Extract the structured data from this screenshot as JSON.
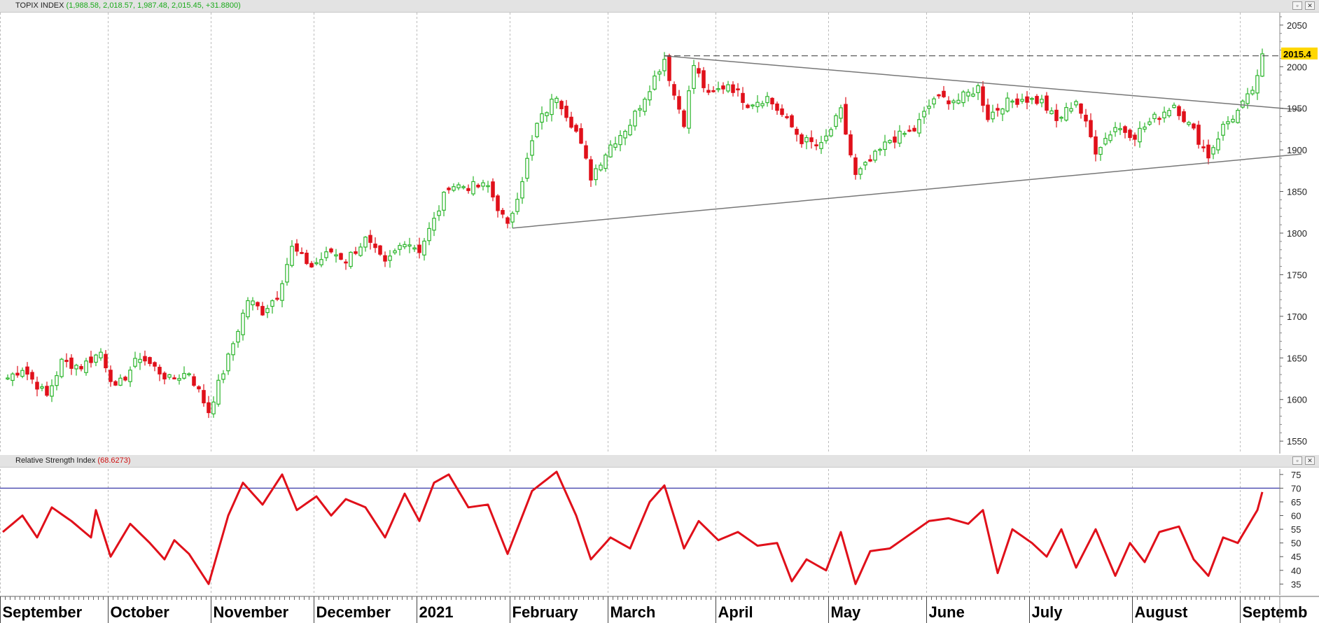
{
  "price_panel": {
    "title": "TOPIX INDEX",
    "values": "(1,988.58, 2,018.57, 1,987.48, 2,015.45, +31.8800)",
    "last_label": "2015.4",
    "buttons": {
      "restore": "▫",
      "close": "✕"
    }
  },
  "rsi_panel": {
    "title": "Relative Strength Index",
    "values": "(68.6273)",
    "buttons": {
      "restore": "▫",
      "close": "✕"
    }
  },
  "colors": {
    "up": "#2cb52c",
    "down": "#e0101a",
    "rsi_line": "#e0101a",
    "rsi_level": "#3a3aa8",
    "trend_line": "#777777",
    "grid": "#bcbcbc",
    "last_label_bg": "#ffd700"
  },
  "chart_data": [
    {
      "type": "candlestick",
      "title": "TOPIX INDEX",
      "y_ticks": [
        1550,
        1600,
        1650,
        1700,
        1750,
        1800,
        1850,
        1900,
        1950,
        2000,
        2050
      ],
      "ylim": [
        1535,
        2065
      ],
      "x_labels": [
        "September",
        "October",
        "November",
        "December",
        "2021",
        "February",
        "March",
        "April",
        "May",
        "June",
        "July",
        "August",
        "Septemb"
      ],
      "x_label_index": [
        0,
        22,
        43,
        64,
        85,
        104,
        124,
        146,
        169,
        189,
        210,
        231,
        253
      ],
      "total_sessions": 260,
      "anchors": [
        {
          "d": 0,
          "c": 1622
        },
        {
          "d": 4,
          "c": 1638
        },
        {
          "d": 9,
          "c": 1604
        },
        {
          "d": 12,
          "c": 1645
        },
        {
          "d": 16,
          "c": 1640
        },
        {
          "d": 20,
          "c": 1657
        },
        {
          "d": 23,
          "c": 1612
        },
        {
          "d": 28,
          "c": 1652
        },
        {
          "d": 34,
          "c": 1624
        },
        {
          "d": 38,
          "c": 1633
        },
        {
          "d": 42,
          "c": 1586
        },
        {
          "d": 46,
          "c": 1650
        },
        {
          "d": 50,
          "c": 1720
        },
        {
          "d": 53,
          "c": 1706
        },
        {
          "d": 56,
          "c": 1726
        },
        {
          "d": 59,
          "c": 1782
        },
        {
          "d": 63,
          "c": 1760
        },
        {
          "d": 67,
          "c": 1778
        },
        {
          "d": 70,
          "c": 1768
        },
        {
          "d": 74,
          "c": 1792
        },
        {
          "d": 78,
          "c": 1762
        },
        {
          "d": 82,
          "c": 1792
        },
        {
          "d": 85,
          "c": 1780
        },
        {
          "d": 88,
          "c": 1815
        },
        {
          "d": 91,
          "c": 1858
        },
        {
          "d": 95,
          "c": 1856
        },
        {
          "d": 99,
          "c": 1856
        },
        {
          "d": 103,
          "c": 1807
        },
        {
          "d": 106,
          "c": 1866
        },
        {
          "d": 109,
          "c": 1930
        },
        {
          "d": 113,
          "c": 1966
        },
        {
          "d": 117,
          "c": 1922
        },
        {
          "d": 120,
          "c": 1868
        },
        {
          "d": 124,
          "c": 1906
        },
        {
          "d": 128,
          "c": 1932
        },
        {
          "d": 132,
          "c": 1976
        },
        {
          "d": 135,
          "c": 2010
        },
        {
          "d": 137,
          "c": 1966
        },
        {
          "d": 139,
          "c": 1934
        },
        {
          "d": 141,
          "c": 2002
        },
        {
          "d": 144,
          "c": 1964
        },
        {
          "d": 148,
          "c": 1980
        },
        {
          "d": 152,
          "c": 1956
        },
        {
          "d": 156,
          "c": 1963
        },
        {
          "d": 160,
          "c": 1935
        },
        {
          "d": 163,
          "c": 1912
        },
        {
          "d": 167,
          "c": 1904
        },
        {
          "d": 171,
          "c": 1946
        },
        {
          "d": 174,
          "c": 1868
        },
        {
          "d": 177,
          "c": 1886
        },
        {
          "d": 181,
          "c": 1912
        },
        {
          "d": 186,
          "c": 1924
        },
        {
          "d": 190,
          "c": 1962
        },
        {
          "d": 195,
          "c": 1960
        },
        {
          "d": 199,
          "c": 1975
        },
        {
          "d": 201,
          "c": 1940
        },
        {
          "d": 204,
          "c": 1955
        },
        {
          "d": 208,
          "c": 1962
        },
        {
          "d": 212,
          "c": 1958
        },
        {
          "d": 215,
          "c": 1934
        },
        {
          "d": 219,
          "c": 1960
        },
        {
          "d": 223,
          "c": 1900
        },
        {
          "d": 227,
          "c": 1928
        },
        {
          "d": 231,
          "c": 1918
        },
        {
          "d": 235,
          "c": 1938
        },
        {
          "d": 239,
          "c": 1955
        },
        {
          "d": 243,
          "c": 1922
        },
        {
          "d": 246,
          "c": 1893
        },
        {
          "d": 249,
          "c": 1928
        },
        {
          "d": 252,
          "c": 1946
        },
        {
          "d": 254,
          "c": 1962
        },
        {
          "d": 256,
          "c": 1984
        },
        {
          "d": 257,
          "c": 2015.45
        }
      ],
      "trendlines": [
        {
          "from": [
            135,
            2013
          ],
          "to": [
            265,
            1948
          ]
        },
        {
          "from": [
            104,
            1806
          ],
          "to": [
            265,
            1895
          ]
        }
      ],
      "resistance_level": 2013,
      "last_value": 2015.45
    },
    {
      "type": "line",
      "title": "Relative Strength Index",
      "y_ticks": [
        35,
        40,
        45,
        50,
        55,
        60,
        65,
        70,
        75
      ],
      "ylim": [
        31,
        77
      ],
      "level": 70,
      "anchors": [
        {
          "d": 0,
          "v": 54
        },
        {
          "d": 4,
          "v": 60
        },
        {
          "d": 7,
          "v": 52
        },
        {
          "d": 10,
          "v": 63
        },
        {
          "d": 14,
          "v": 58
        },
        {
          "d": 18,
          "v": 52
        },
        {
          "d": 19,
          "v": 62
        },
        {
          "d": 22,
          "v": 45
        },
        {
          "d": 26,
          "v": 57
        },
        {
          "d": 30,
          "v": 50
        },
        {
          "d": 33,
          "v": 44
        },
        {
          "d": 35,
          "v": 51
        },
        {
          "d": 38,
          "v": 46
        },
        {
          "d": 42,
          "v": 35
        },
        {
          "d": 46,
          "v": 60
        },
        {
          "d": 49,
          "v": 72
        },
        {
          "d": 53,
          "v": 64
        },
        {
          "d": 57,
          "v": 75
        },
        {
          "d": 60,
          "v": 62
        },
        {
          "d": 64,
          "v": 67
        },
        {
          "d": 67,
          "v": 60
        },
        {
          "d": 70,
          "v": 66
        },
        {
          "d": 74,
          "v": 63
        },
        {
          "d": 78,
          "v": 52
        },
        {
          "d": 82,
          "v": 68
        },
        {
          "d": 85,
          "v": 58
        },
        {
          "d": 88,
          "v": 72
        },
        {
          "d": 91,
          "v": 75
        },
        {
          "d": 95,
          "v": 63
        },
        {
          "d": 99,
          "v": 64
        },
        {
          "d": 103,
          "v": 46
        },
        {
          "d": 108,
          "v": 69
        },
        {
          "d": 113,
          "v": 76
        },
        {
          "d": 117,
          "v": 60
        },
        {
          "d": 120,
          "v": 44
        },
        {
          "d": 124,
          "v": 52
        },
        {
          "d": 128,
          "v": 48
        },
        {
          "d": 132,
          "v": 65
        },
        {
          "d": 135,
          "v": 71
        },
        {
          "d": 139,
          "v": 48
        },
        {
          "d": 142,
          "v": 58
        },
        {
          "d": 146,
          "v": 51
        },
        {
          "d": 150,
          "v": 54
        },
        {
          "d": 154,
          "v": 49
        },
        {
          "d": 158,
          "v": 50
        },
        {
          "d": 161,
          "v": 36
        },
        {
          "d": 164,
          "v": 44
        },
        {
          "d": 168,
          "v": 40
        },
        {
          "d": 171,
          "v": 54
        },
        {
          "d": 174,
          "v": 35
        },
        {
          "d": 177,
          "v": 47
        },
        {
          "d": 181,
          "v": 48
        },
        {
          "d": 185,
          "v": 53
        },
        {
          "d": 189,
          "v": 58
        },
        {
          "d": 193,
          "v": 59
        },
        {
          "d": 197,
          "v": 57
        },
        {
          "d": 200,
          "v": 62
        },
        {
          "d": 203,
          "v": 39
        },
        {
          "d": 206,
          "v": 55
        },
        {
          "d": 210,
          "v": 50
        },
        {
          "d": 213,
          "v": 45
        },
        {
          "d": 216,
          "v": 55
        },
        {
          "d": 219,
          "v": 41
        },
        {
          "d": 223,
          "v": 55
        },
        {
          "d": 227,
          "v": 38
        },
        {
          "d": 230,
          "v": 50
        },
        {
          "d": 233,
          "v": 43
        },
        {
          "d": 236,
          "v": 54
        },
        {
          "d": 240,
          "v": 56
        },
        {
          "d": 243,
          "v": 44
        },
        {
          "d": 246,
          "v": 38
        },
        {
          "d": 249,
          "v": 52
        },
        {
          "d": 252,
          "v": 50
        },
        {
          "d": 254,
          "v": 56
        },
        {
          "d": 256,
          "v": 62
        },
        {
          "d": 257,
          "v": 68.6
        }
      ]
    }
  ]
}
